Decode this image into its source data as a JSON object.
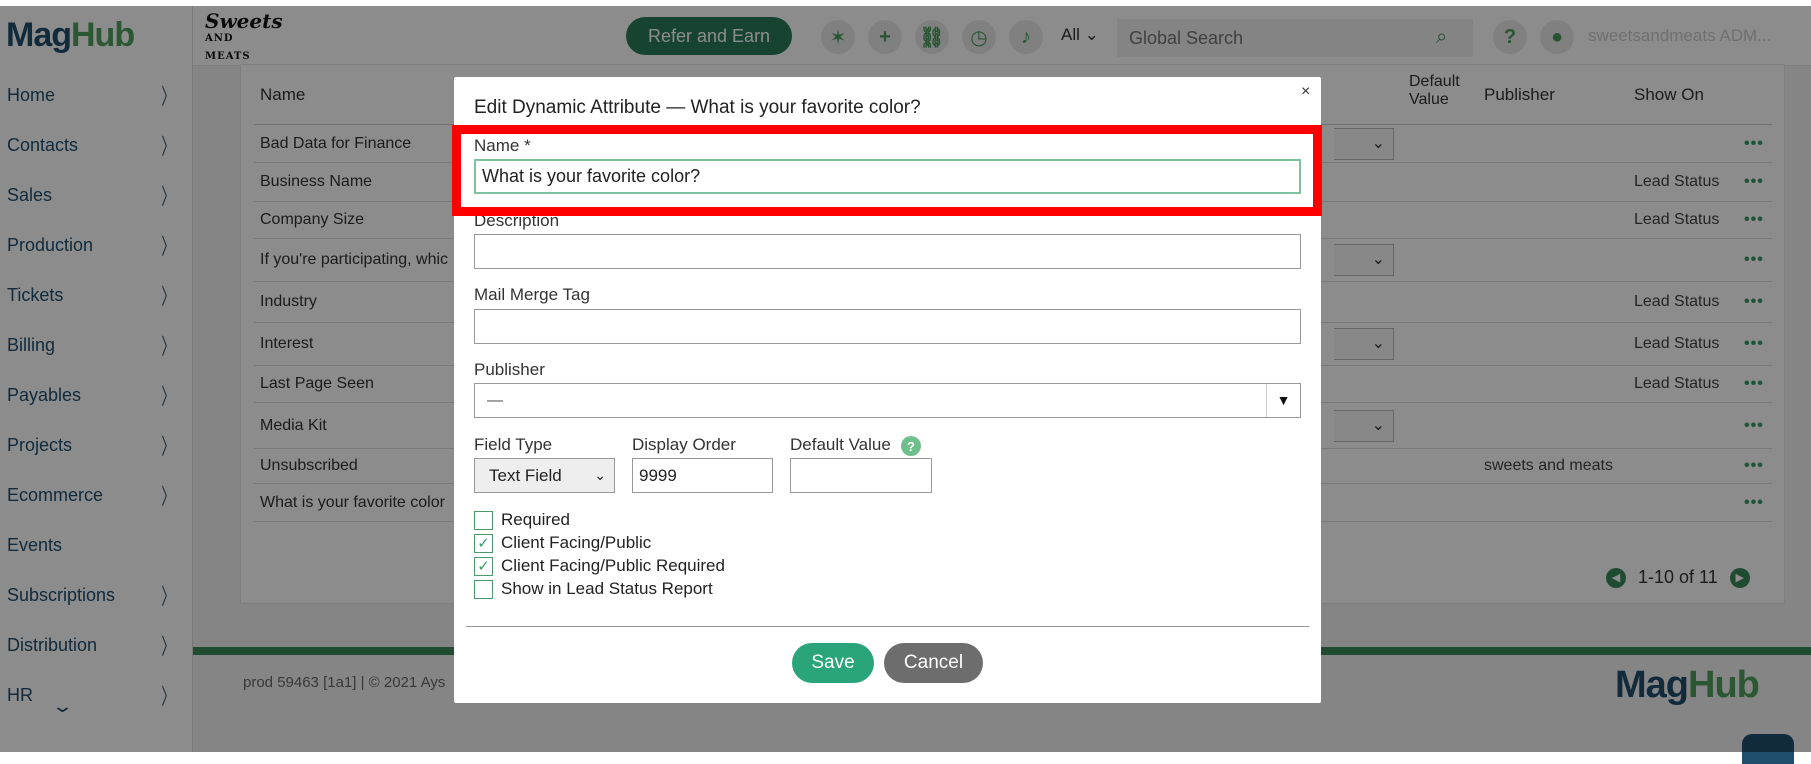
{
  "app": {
    "logo_mag": "Mag",
    "logo_hub": "Hub",
    "brand_top": "Sweets",
    "brand_bottom": "AND MEATS"
  },
  "sidebar": {
    "items": [
      {
        "label": "Home",
        "chevron": "〉"
      },
      {
        "label": "Contacts",
        "chevron": "〉"
      },
      {
        "label": "Sales",
        "chevron": "〉"
      },
      {
        "label": "Production",
        "chevron": "〉"
      },
      {
        "label": "Tickets",
        "chevron": "〉"
      },
      {
        "label": "Billing",
        "chevron": "〉"
      },
      {
        "label": "Payables",
        "chevron": "〉"
      },
      {
        "label": "Projects",
        "chevron": "〉"
      },
      {
        "label": "Ecommerce",
        "chevron": "〉"
      },
      {
        "label": "Events",
        "chevron": ""
      },
      {
        "label": "Subscriptions",
        "chevron": "〉"
      },
      {
        "label": "Distribution",
        "chevron": "〉"
      },
      {
        "label": "HR",
        "chevron": "〉"
      }
    ],
    "more_icon": "⌄"
  },
  "header": {
    "refer_label": "Refer and Earn",
    "search_scope": "All ⌄",
    "search_placeholder": "Global Search",
    "user_name": "sweetsandmeats ADM...",
    "icons": [
      "party-icon",
      "plus-icon",
      "link-icon",
      "history-icon",
      "bell-icon",
      "help-icon",
      "user-icon"
    ]
  },
  "table": {
    "headers": {
      "name": "Name",
      "default_value": "Default\nValue",
      "publisher": "Publisher",
      "show_on": "Show On"
    },
    "rows": [
      {
        "name": "Bad Data for Finance",
        "show_on": "",
        "publisher": "",
        "has_select": true
      },
      {
        "name": "Business Name",
        "show_on": "Lead Status",
        "publisher": "",
        "has_select": false
      },
      {
        "name": "Company Size",
        "show_on": "Lead Status",
        "publisher": "",
        "has_select": false
      },
      {
        "name": "If you're participating, whic",
        "show_on": "",
        "publisher": "",
        "has_select": true
      },
      {
        "name": "Industry",
        "show_on": "Lead Status",
        "publisher": "",
        "has_select": false
      },
      {
        "name": "Interest",
        "show_on": "Lead Status",
        "publisher": "",
        "has_select": true
      },
      {
        "name": "Last Page Seen",
        "show_on": "Lead Status",
        "publisher": "",
        "has_select": false
      },
      {
        "name": "Media Kit",
        "show_on": "",
        "publisher": "",
        "has_select": true
      },
      {
        "name": "Unsubscribed",
        "show_on": "",
        "publisher": "sweets and meats",
        "has_select": false
      },
      {
        "name": "What is your favorite color",
        "show_on": "",
        "publisher": "",
        "has_select": false
      }
    ],
    "row_menu": "•••",
    "pager_text": "1-10 of 11"
  },
  "footer": {
    "text": "prod 59463 [1a1] | © 2021 Ays",
    "logo_mag": "Mag",
    "logo_hub": "Hub"
  },
  "modal": {
    "title": "Edit Dynamic Attribute — What is your favorite color?",
    "close": "×",
    "name_label": "Name *",
    "name_value": "What is your favorite color?",
    "description_label": "Description",
    "description_value": "",
    "mail_merge_label": "Mail Merge Tag",
    "mail_merge_value": "",
    "publisher_label": "Publisher",
    "publisher_value": "—",
    "field_type_label": "Field Type",
    "field_type_value": "Text Field",
    "display_order_label": "Display Order",
    "display_order_value": "9999",
    "default_value_label": "Default Value",
    "default_value_value": "",
    "help_glyph": "?",
    "checkboxes": [
      {
        "label": "Required",
        "checked": false
      },
      {
        "label": "Client Facing/Public",
        "checked": true
      },
      {
        "label": "Client Facing/Public Required",
        "checked": true
      },
      {
        "label": "Show in Lead Status Report",
        "checked": false
      }
    ],
    "save_label": "Save",
    "cancel_label": "Cancel"
  },
  "colors": {
    "accent_green": "#2aa57a",
    "brand_blue": "#1f4e6e",
    "highlight_red": "#ff0000"
  }
}
